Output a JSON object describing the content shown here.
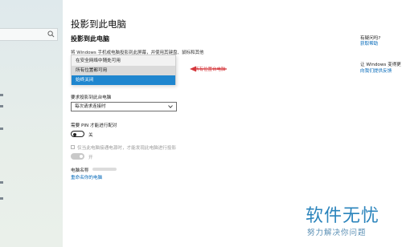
{
  "page": {
    "title": "投影到此电脑",
    "section_title": "投影到此电脑",
    "description": "将 Windows 手机或电脑投影到此屏幕，并使用其键盘、鼠标和其他",
    "dropdown": {
      "options": [
        "在安全网络中随处可用",
        "所有位置都可用",
        "始终关闭"
      ],
      "highlighted_index": 1,
      "selected_index": 2
    },
    "annotation": "所有位置台电脑",
    "request_label": "要求投影到此台电脑",
    "request_select_value": "每次请求连接时",
    "pin_label": "需要 PIN 才能进行配对",
    "pin_toggle_state": "关",
    "power_checkbox_label": "仅当此电脑接通电源时，才能发现此电脑进行投影",
    "discover_toggle_state": "开",
    "pc_name_label": "电脑名称",
    "rename_link": "重命名你的电脑"
  },
  "right_panel": {
    "question": "有疑问吗?",
    "help_link": "获取帮助",
    "improve_text": "让 Windows 变得更",
    "feedback_link": "向我们提供反馈"
  },
  "watermark": {
    "title": "软件无忧",
    "subtitle": "努力解决你问题"
  },
  "colors": {
    "accent": "#1f86cf",
    "link": "#0067b8",
    "annotation": "#d5373c",
    "watermark": "#2b84bc"
  }
}
